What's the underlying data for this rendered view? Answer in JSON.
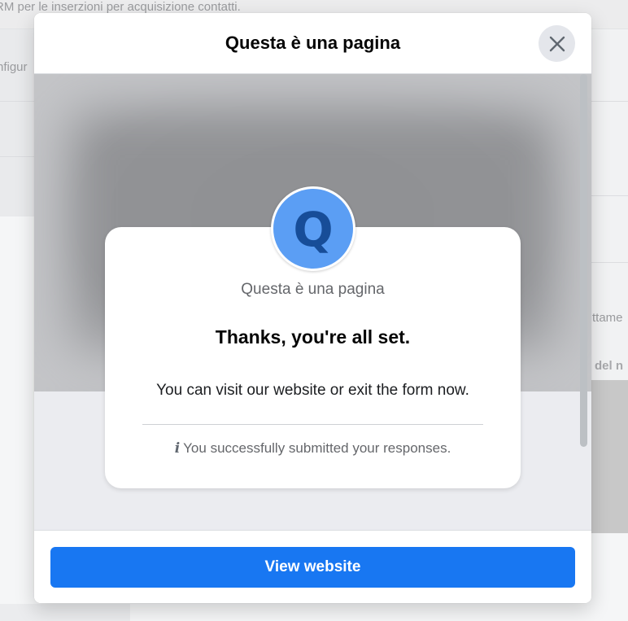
{
  "background": {
    "top_text": "RM per le inserzioni per acquisizione contatti.",
    "left_text": "nfigur",
    "right_text_1": "ttame",
    "right_text_2": "del n"
  },
  "dialog": {
    "title": "Questa è una pagina",
    "close_icon": "close-icon"
  },
  "card": {
    "avatar_letter": "Q",
    "avatar_color": "#5b9ef4",
    "page_name": "Questa è una pagina",
    "thanks_title": "Thanks, you're all set.",
    "thanks_body": "You can visit our website or exit the form now.",
    "info_icon": "i",
    "info_text": "You successfully submitted your responses."
  },
  "footer": {
    "view_website_label": "View website",
    "button_color": "#1877f2"
  }
}
